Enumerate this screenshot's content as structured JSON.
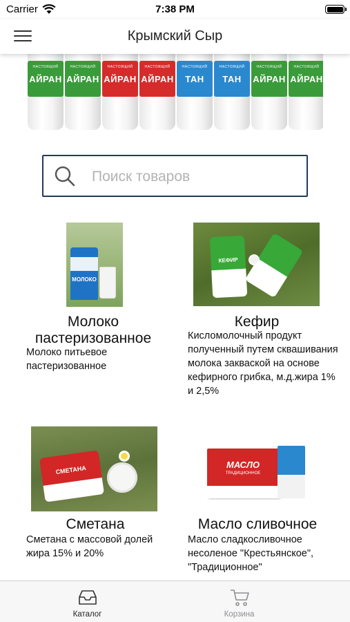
{
  "status_bar": {
    "carrier": "Carrier",
    "time": "7:38 PM"
  },
  "nav": {
    "title": "Крымский Сыр",
    "menu_icon": "hamburger-menu-icon"
  },
  "banner": {
    "bottles": [
      {
        "label": "АЙРАН",
        "color": "#3a9b3a"
      },
      {
        "label": "АЙРАН",
        "color": "#3a9b3a"
      },
      {
        "label": "АЙРАН",
        "color": "#d62b2b"
      },
      {
        "label": "АЙРАН",
        "color": "#d62b2b"
      },
      {
        "label": "ТАН",
        "color": "#2a88cf"
      },
      {
        "label": "ТАН",
        "color": "#2a88cf"
      },
      {
        "label": "АЙРАН",
        "color": "#3a9b3a"
      },
      {
        "label": "АЙРАН",
        "color": "#3a9b3a"
      }
    ],
    "small_text": "НАСТОЯЩИЙ"
  },
  "search": {
    "placeholder": "Поиск товаров",
    "value": ""
  },
  "products": [
    {
      "name": "Молоко пастеризованное",
      "description": "Молоко питьевое пастеризованное",
      "pack_text": "МОЛОКО"
    },
    {
      "name": "Кефир",
      "description": "Кисломолочный продукт полученный путем сквашивания молока закваской на основе кефирного грибка, м.д.жира 1% и 2,5%",
      "pack_text": "КЕФИР"
    },
    {
      "name": "Сметана",
      "description": "Сметана с массовой долей жира 15% и 20%",
      "pack_text": "СМЕТАНА"
    },
    {
      "name": "Масло сливочное",
      "description": "Масло сладкосливочное несоленое \"Крестьянское\", \"Традиционное\"",
      "pack_text": "МАСЛО",
      "pack_subtext": "ТРАДИЦИОННОЕ"
    }
  ],
  "tabs": [
    {
      "label": "Каталог",
      "icon": "catalog-tray-icon",
      "active": true
    },
    {
      "label": "Корзина",
      "icon": "shopping-cart-icon",
      "active": false
    }
  ],
  "colors": {
    "search_border": "#1f3a5a",
    "tab_active": "#222222",
    "tab_inactive": "#8e8e93",
    "milk_blue": "#1e73c4",
    "kefir_green": "#38a838",
    "brand_red": "#d32626"
  }
}
